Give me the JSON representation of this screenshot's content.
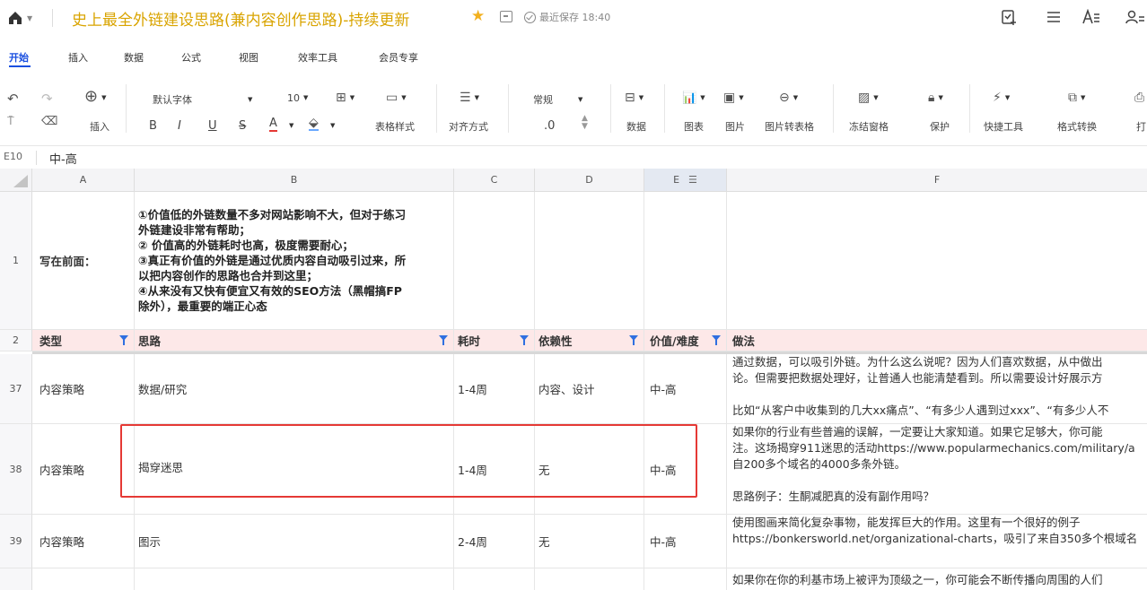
{
  "titlebar": {
    "doc_title": "史上最全外链建设思路(兼内容创作思路)-持续更新",
    "saved_status": "最近保存 18:40"
  },
  "menu_tabs": [
    "开始",
    "插入",
    "数据",
    "公式",
    "视图",
    "效率工具",
    "会员专享"
  ],
  "toolbar": {
    "insert_label": "插入",
    "font_name": "默认字体",
    "font_size": "10",
    "bold": "B",
    "italic": "I",
    "underline": "U",
    "strike": "S",
    "font_color": "A",
    "table_style": "表格样式",
    "align": "对齐方式",
    "number_format": "常规",
    "decimal": ".0",
    "data": "数据",
    "chart": "图表",
    "image": "图片",
    "image_to_table": "图片转表格",
    "freeze": "冻结窗格",
    "protect": "保护",
    "quick_tools": "快捷工具",
    "format_convert": "格式转换",
    "print": "打"
  },
  "formula_bar": {
    "cell_ref": "E10",
    "value": "中-高"
  },
  "columns": [
    "A",
    "B",
    "C",
    "D",
    "E",
    "F"
  ],
  "rows": {
    "r1": {
      "num": "1",
      "a": "写在前面：",
      "b_lines": [
        "①价值低的外链数量不多对网站影响不大，但对于练习",
        "外链建设非常有帮助；",
        "② 价值高的外链耗时也高，极度需要耐心；",
        "③真正有价值的外链是通过优质内容自动吸引过来，所",
        "以把内容创作的思路也合并到这里；",
        "④从来没有又快有便宜又有效的SEO方法（黑帽搞FP",
        "除外），最重要的端正心态"
      ]
    },
    "r2": {
      "num": "2",
      "a": "类型",
      "b": "思路",
      "c": "耗时",
      "d": "依赖性",
      "e": "价值/难度",
      "f": "做法"
    },
    "r37": {
      "num": "37",
      "a": "内容策略",
      "b": "数据/研究",
      "c": "1-4周",
      "d": "内容、设计",
      "e": "中-高",
      "f_lines": [
        "通过数据，可以吸引外链。为什么这么说呢？因为人们喜欢数据，从中做出",
        "论。但需要把数据处理好，让普通人也能清楚看到。所以需要设计好展示方",
        "",
        "比如“从客户中收集到的几大xx痛点”、“有多少人遇到过xxx”、“有多少人不"
      ]
    },
    "r38": {
      "num": "38",
      "a": "内容策略",
      "b": "揭穿迷思",
      "c": "1-4周",
      "d": "无",
      "e": "中-高",
      "f_lines": [
        "如果你的行业有些普遍的误解，一定要让大家知道。如果它足够大，你可能",
        "注。这场揭穿911迷思的活动https://www.popularmechanics.com/military/a",
        "自200多个域名的4000多条外链。",
        "",
        "思路例子：生酮减肥真的没有副作用吗？"
      ]
    },
    "r39": {
      "num": "39",
      "a": "内容策略",
      "b": "图示",
      "c": "2-4周",
      "d": "无",
      "e": "中-高",
      "f_lines": [
        "使用图画来简化复杂事物，能发挥巨大的作用。这里有一个很好的例子",
        "https://bonkersworld.net/organizational-charts，吸引了来自350多个根域名"
      ]
    },
    "r40": {
      "f_lines": [
        "如果你在你的利基市场上被评为顶级之一，你可能会不断传播向周围的人们"
      ]
    }
  }
}
